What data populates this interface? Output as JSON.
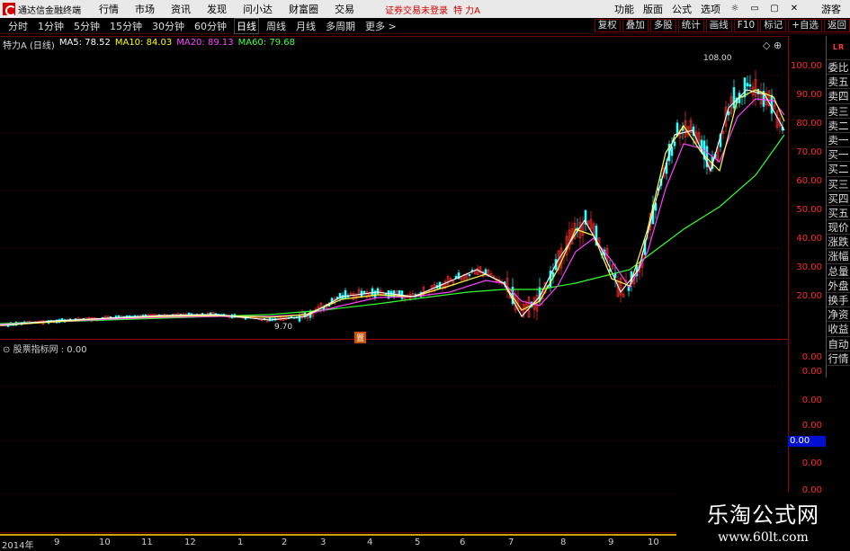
{
  "menubar": {
    "app_title": "通达信金融终端",
    "items": [
      "行情",
      "市场",
      "资讯",
      "发现",
      "问小达",
      "财富圈",
      "交易"
    ],
    "trade_status": "证券交易未登录",
    "stock_title": "特 力A",
    "right_items": [
      "功能",
      "版面",
      "公式",
      "选项"
    ],
    "guest": "游客"
  },
  "periods": [
    "分时",
    "1分钟",
    "5分钟",
    "15分钟",
    "30分钟",
    "60分钟",
    "日线",
    "周线",
    "月线",
    "多周期",
    "更多 >"
  ],
  "active_period": "日线",
  "tools": [
    "复权",
    "叠加",
    "多股",
    "统计",
    "画线",
    "F10",
    "标记",
    "+自选",
    "返回"
  ],
  "legend": {
    "title": "特力A (日线)",
    "ma5": "MA5: 78.52",
    "ma10": "MA10: 84.03",
    "ma20": "MA20: 89.13",
    "ma60": "MA60: 79.68",
    "colors": {
      "ma5": "#ffffff",
      "ma10": "#ffff00",
      "ma20": "#ff40ff",
      "ma60": "#40ff40"
    }
  },
  "price_axis": [
    "100.00",
    "90.00",
    "80.00",
    "70.00",
    "60.00",
    "50.00",
    "40.00",
    "30.00",
    "20.00"
  ],
  "annotations": {
    "high": "108.00",
    "low": "9.70",
    "marker": "置"
  },
  "sidebar": {
    "top": [
      "L",
      "R"
    ],
    "items": [
      "委比",
      "卖五",
      "卖四",
      "卖三",
      "卖二",
      "卖一",
      "买一",
      "买二",
      "买三",
      "买四",
      "买五",
      "现价",
      "涨跌",
      "涨幅",
      "总量",
      "外盘",
      "换手",
      "净资",
      "收益"
    ],
    "auto": [
      "自动",
      "行情"
    ]
  },
  "sub": {
    "legend": "股票指标网 : 0.00",
    "axis": [
      "0.00",
      "0.00",
      "0.00",
      "0.00",
      "0.00",
      "0.00"
    ],
    "current": "0.00"
  },
  "timeline": [
    "2014年",
    "9",
    "10",
    "11",
    "12",
    "1",
    "2",
    "3",
    "4",
    "5",
    "6",
    "7",
    "8",
    "9",
    "10"
  ],
  "watermark": {
    "title": "乐淘公式网",
    "url": "www.60lt.com"
  }
}
